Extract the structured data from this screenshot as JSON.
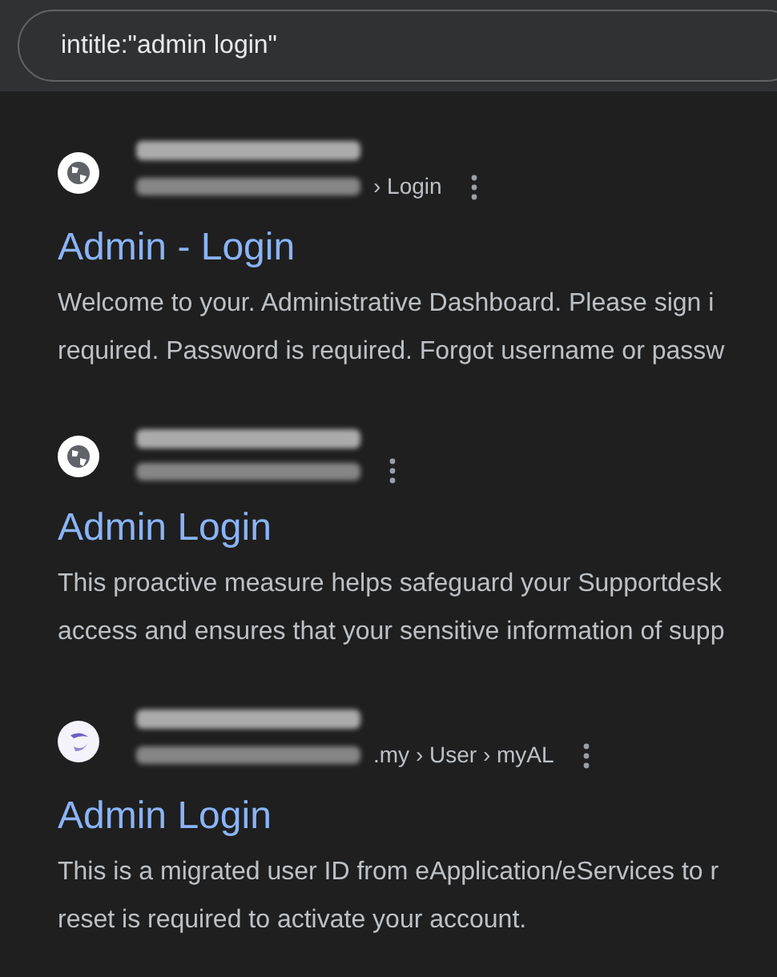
{
  "search": {
    "value": "intitle:\"admin login\""
  },
  "results": [
    {
      "kind": "globe",
      "url_tail": "› Login",
      "title": "Admin - Login",
      "snippet": [
        "Welcome to your. Administrative Dashboard. Please sign i",
        "required. Password is required. Forgot username or passw"
      ]
    },
    {
      "kind": "globe",
      "title": "Admin Login",
      "snippet": [
        "This proactive measure helps safeguard your Supportdesk",
        "access and ensures that your sensitive information of supp"
      ]
    },
    {
      "kind": "logo",
      "url_tail": ".my › User › myAL",
      "title": "Admin Login",
      "snippet": [
        "This is a migrated user ID from eApplication/eServices to r",
        "reset is required to activate your account."
      ]
    }
  ]
}
